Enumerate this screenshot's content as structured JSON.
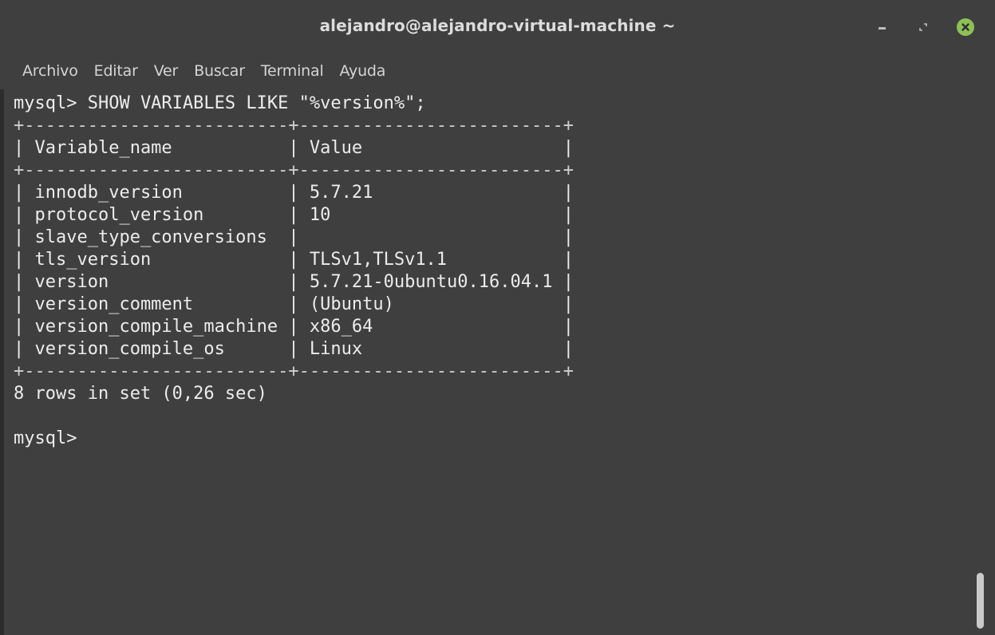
{
  "window": {
    "title": "alejandro@alejandro-virtual-machine ~"
  },
  "menu": {
    "items": [
      "Archivo",
      "Editar",
      "Ver",
      "Buscar",
      "Terminal",
      "Ayuda"
    ]
  },
  "terminal": {
    "command_line": "mysql> SHOW VARIABLES LIKE \"%version%\";",
    "border_line": "+-------------------------+-------------------------+",
    "header_row": "| Variable_name           | Value                   |",
    "rows": [
      "| innodb_version          | 5.7.21                  |",
      "| protocol_version        | 10                      |",
      "| slave_type_conversions  |                         |",
      "| tls_version             | TLSv1,TLSv1.1           |",
      "| version                 | 5.7.21-0ubuntu0.16.04.1 |",
      "| version_comment         | (Ubuntu)                |",
      "| version_compile_machine | x86_64                  |",
      "| version_compile_os      | Linux                   |"
    ],
    "result_summary": "8 rows in set (0,26 sec)",
    "prompt": "mysql>"
  },
  "icons": {
    "minimize": "minimize-icon",
    "maximize": "maximize-icon",
    "close": "close-icon"
  },
  "colors": {
    "background": "#3f3f3f",
    "text": "#ececec",
    "close_button": "#8ec155"
  }
}
